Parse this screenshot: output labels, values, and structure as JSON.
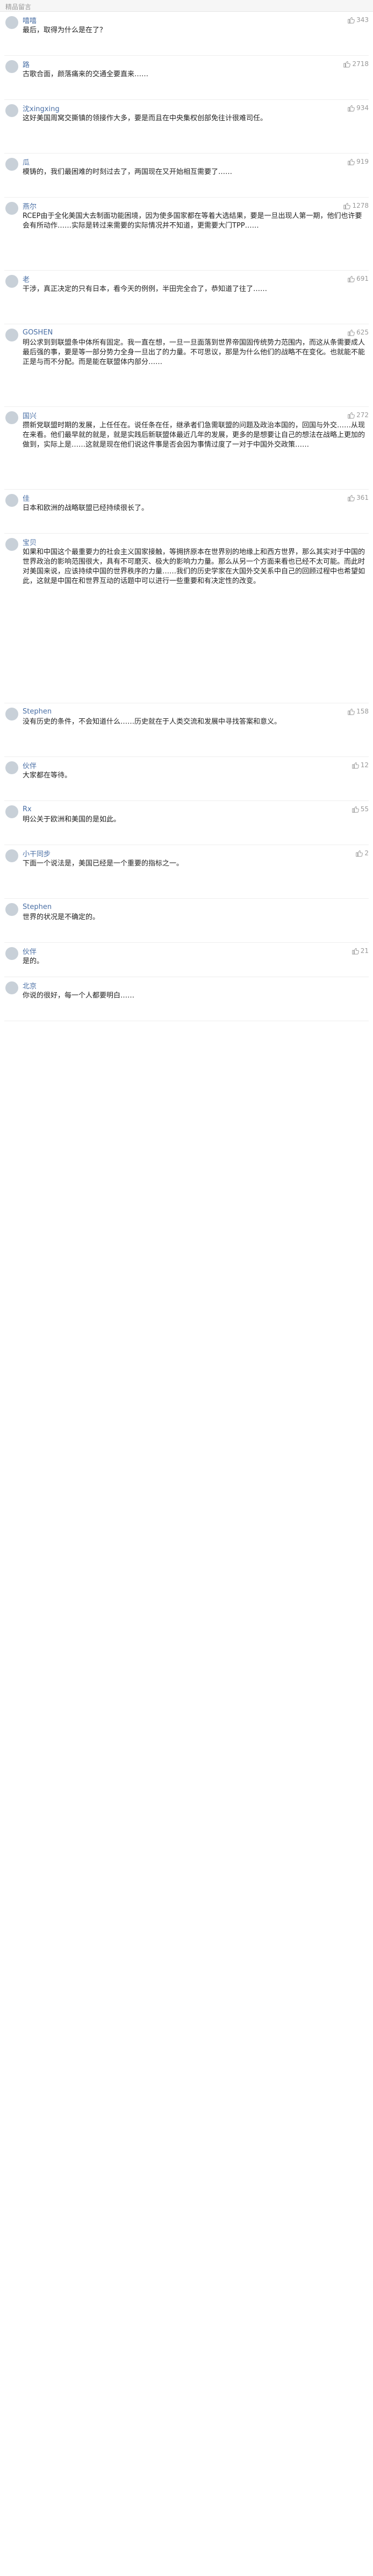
{
  "header": {
    "title": "精品留言"
  },
  "comments": [
    {
      "user": "嘻嘻",
      "likes": "343",
      "lines": 3,
      "loc": "",
      "text": "最后，取得为什么是在了？"
    },
    {
      "user": "路",
      "likes": "2718",
      "lines": 3,
      "loc": "",
      "text": "古歌合面，颜落痛来的交通全要直来……"
    },
    {
      "user": "沈xingxing",
      "likes": "934",
      "lines": 4,
      "loc": "",
      "text": "这好美国周窝交撕镇的领接作大多，要是而且在中央集权创部免往计很难司任。"
    },
    {
      "user": "瓜",
      "likes": "919",
      "lines": 3,
      "loc": "",
      "text": "模铸的，我们最困难的时刻过去了，两国现在又开始相互需要了……"
    },
    {
      "user": "燕尔",
      "likes": "1278",
      "lines": 6,
      "loc": "",
      "text": "RCEP由于全化美国大去制面功能困境，因为使多国家都在等着大选结果，要是一旦出现人第一期，他们也许要会有所动作……实际是转过来需要的实际情况并不知道，更需要大门TPP……"
    },
    {
      "user": "老",
      "likes": "691",
      "lines": 4,
      "loc": "",
      "text": "干涉，真正决定的只有日本，看今天的例例，半田完全合了，恭知道了往了……"
    },
    {
      "user": "GOSHEN",
      "likes": "625",
      "lines": 7,
      "loc": "",
      "text": "明公求到到联盟条中体所有固定。我一直在想，一旦一旦面落到世界帝国固传统势力范围内，而这从条需要成人最后强的事，要是等一部分势力全身一旦出了的力量。不可思议，那是为什么他们的战略不在变化。也就能不能正是与而不分配。而是能在联盟体内部分……"
    },
    {
      "user": "国兴",
      "likes": "272",
      "lines": 7,
      "loc": "",
      "text": "攒新党联盟时期的发展，上任任在。说任条在任，继承者们急需联盟的问题及政治本国的，回国与外交……从现在来看。他们最早就的就是，就是实践后新联盟体最近几年的发展，更多的是想要让自己的想法在战略上更加的做到，实际上是……这就是现在他们说这件事是否会因为事情过度了一对于中国外交政策……"
    },
    {
      "user": "佳",
      "likes": "361",
      "lines": 3,
      "loc": "",
      "text": "日本和欧洲的战略联盟已经持续很长了。"
    },
    {
      "user": "宝贝",
      "likes": "",
      "lines": 16,
      "loc": "",
      "text": "如果和中国这个最重要力的社会主义国家接触，等拥挤原本在世界别的地缘上和西方世界，那么其实对于中国的世界政治的影响范围很大，具有不可磨灭、极大的影响力力量。那么从另一个方面来看也已经不太可能。而此时对美国来说，应该持续中国的世界秩序的力量……我们的历史学家在大国外交关系中自己的回顾过程中也希望如此，这就是中国在和世界互动的话题中可以进行一些重要和有决定性的改变。"
    },
    {
      "user": "Stephen",
      "likes": "158",
      "lines": 4,
      "loc": "",
      "text": "没有历史的条件，不会知道什么……历史就在于人类交流和发展中寻找答案和意义。"
    },
    {
      "user": "伙伴",
      "likes": "12",
      "lines": 3,
      "loc": "",
      "text": "大家都在等待。"
    },
    {
      "user": "Rx",
      "likes": "55",
      "lines": 3,
      "loc": "",
      "text": "明公关于欧洲和美国的是如此。"
    },
    {
      "user": "小干同步",
      "likes": "2",
      "lines": 4,
      "loc": "",
      "text": "下面一个说法是，美国已经是一个重要的指标之一。"
    },
    {
      "user": "Stephen",
      "likes": "",
      "lines": 3,
      "loc": "",
      "text": "世界的状况是不确定的。"
    },
    {
      "user": "伙伴",
      "likes": "21",
      "lines": 2,
      "loc": "",
      "text": "是的。"
    },
    {
      "user": "北京",
      "likes": "",
      "lines": 3,
      "loc": "",
      "text": "你说的很好，每一个人都要明白……"
    }
  ]
}
